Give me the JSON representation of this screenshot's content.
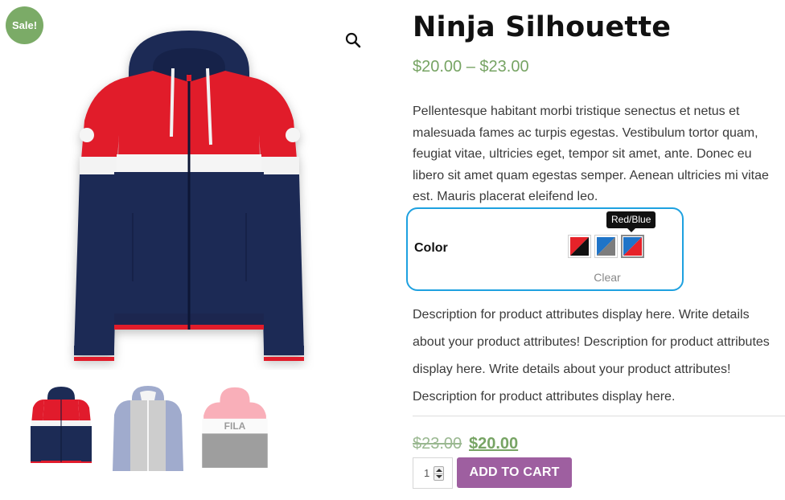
{
  "gallery": {
    "sale_badge": "Sale!",
    "zoom_icon": "search-icon",
    "thumbnails": [
      "thumbnail-red-blue-hoodie",
      "thumbnail-grey-blue-hoodie",
      "thumbnail-fila-hoodie"
    ]
  },
  "product": {
    "title": "Ninja Silhouette",
    "price_range": "$20.00 – $23.00",
    "short_description": "Pellentesque habitant morbi tristique senectus et netus et malesuada fames ac turpis egestas. Vestibulum tortor quam, feugiat vitae, ultricies eget, tempor sit amet, ante. Donec eu libero sit amet quam egestas semper. Aenean ultricies mi vitae est. Mauris placerat eleifend leo.",
    "attribute_description": "Description for product attributes display here. Write details about your product attributes! Description for product attributes display here. Write details about your product attributes! Description for product attributes display here."
  },
  "variations": {
    "label": "Color",
    "swatches": [
      {
        "name": "Red/Black",
        "colors": [
          "#e62229",
          "#111111"
        ]
      },
      {
        "name": "Blue/Grey",
        "colors": [
          "#1f74c8",
          "#7d7d7d"
        ]
      },
      {
        "name": "Red/Blue",
        "colors": [
          "#1f74c8",
          "#e62229"
        ]
      }
    ],
    "selected": "Red/Blue",
    "tooltip": "Red/Blue",
    "clear_label": "Clear"
  },
  "cart": {
    "old_price": "$23.00",
    "sale_price": "$20.00",
    "quantity": "1",
    "add_to_cart_label": "ADD TO CART"
  },
  "colors": {
    "price_green": "#77a464",
    "button_purple": "#9e5fa0",
    "sale_badge_green": "#7bab67",
    "highlight_blue": "#1ea1e0"
  }
}
